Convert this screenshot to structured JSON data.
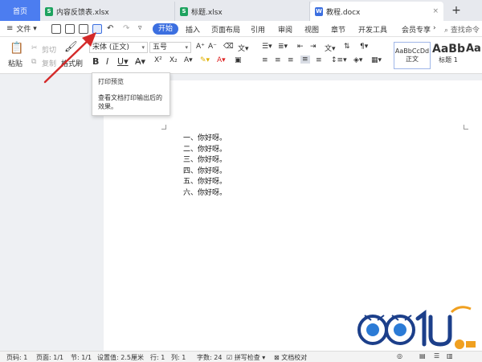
{
  "tabs": {
    "home": "首页",
    "items": [
      {
        "label": "内容反馈表.xlsx",
        "type": "xls"
      },
      {
        "label": "标题.xlsx",
        "type": "xls"
      },
      {
        "label": "教程.docx",
        "type": "doc"
      }
    ],
    "close_glyph": "×",
    "plus_glyph": "+"
  },
  "menu": {
    "file": "文件",
    "items": [
      "开始",
      "插入",
      "页面布局",
      "引用",
      "审阅",
      "视图",
      "章节",
      "开发工具",
      "会员专享"
    ],
    "search": "查找命令"
  },
  "ribbon": {
    "paste": "粘贴",
    "cut": "剪切",
    "copy": "复制",
    "format_painter": "格式刷",
    "font_name": "宋体 (正文)",
    "font_size": "五号",
    "bold": "B",
    "italic": "I",
    "underline": "U",
    "styles": [
      {
        "preview": "AaBbCcDd",
        "label": "正文"
      },
      {
        "preview": "AaBb",
        "label": "标题 1"
      },
      {
        "preview": "AaI",
        "label": ""
      }
    ]
  },
  "tooltip": {
    "title": "打印预览",
    "description": "查看文档打印输出后的效果。"
  },
  "document": {
    "lines": [
      "一、你好呀。",
      "二、你好呀。",
      "三、你好呀。",
      "四、你好呀。",
      "五、你好呀。",
      "六、你好呀。"
    ]
  },
  "status": {
    "page_num": "页码: 1",
    "pages": "页面: 1/1",
    "section": "节: 1/1",
    "setting": "设置值: 2.5厘米",
    "row": "行: 1",
    "col": "列: 1",
    "words": "字数: 24",
    "spell": "拼写检查",
    "proofread": "文档校对"
  },
  "colors": {
    "accent": "#3c6fe0",
    "home_tab": "#4c7df0",
    "arrow": "#d42a2a"
  }
}
